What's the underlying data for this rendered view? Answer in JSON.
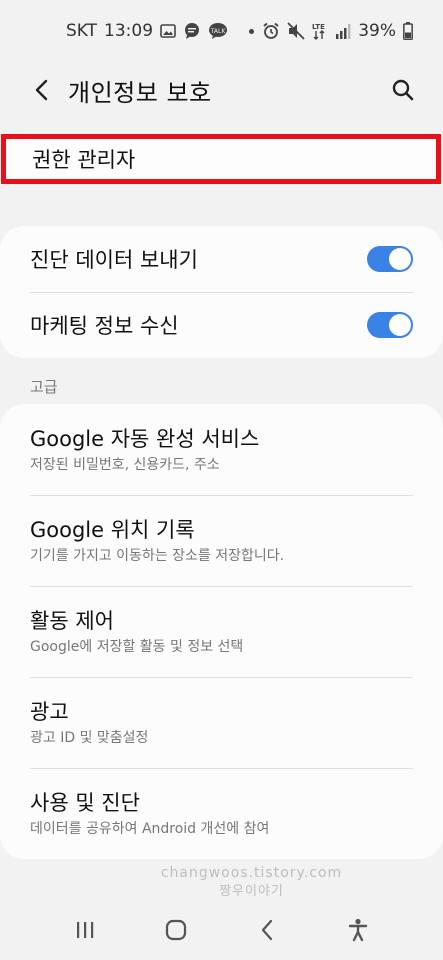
{
  "status_bar": {
    "carrier": "SKT",
    "time": "13:09",
    "network": "LTE",
    "battery": "39%"
  },
  "app_bar": {
    "title": "개인정보 보호"
  },
  "highlighted_item": {
    "label": "권한 관리자"
  },
  "toggles": [
    {
      "label": "진단 데이터 보내기",
      "on": true
    },
    {
      "label": "마케팅 정보 수신",
      "on": true
    }
  ],
  "advanced": {
    "header": "고급",
    "items": [
      {
        "title": "Google 자동 완성 서비스",
        "subtitle": "저장된 비밀번호, 신용카드, 주소"
      },
      {
        "title": "Google 위치 기록",
        "subtitle": "기기를 가지고 이동하는 장소를 저장합니다."
      },
      {
        "title": "활동 제어",
        "subtitle": "Google에 저장할 활동 및 정보 선택"
      },
      {
        "title": "광고",
        "subtitle": "광고 ID 및 맞춤설정"
      },
      {
        "title": "사용 및 진단",
        "subtitle": "데이터를 공유하여 Android 개선에 참여"
      }
    ]
  },
  "watermark": {
    "line1": "changwoos.tistory.com",
    "line2": "짱우이야기"
  },
  "colors": {
    "accent": "#3a82e6",
    "highlight": "#e8101a"
  }
}
